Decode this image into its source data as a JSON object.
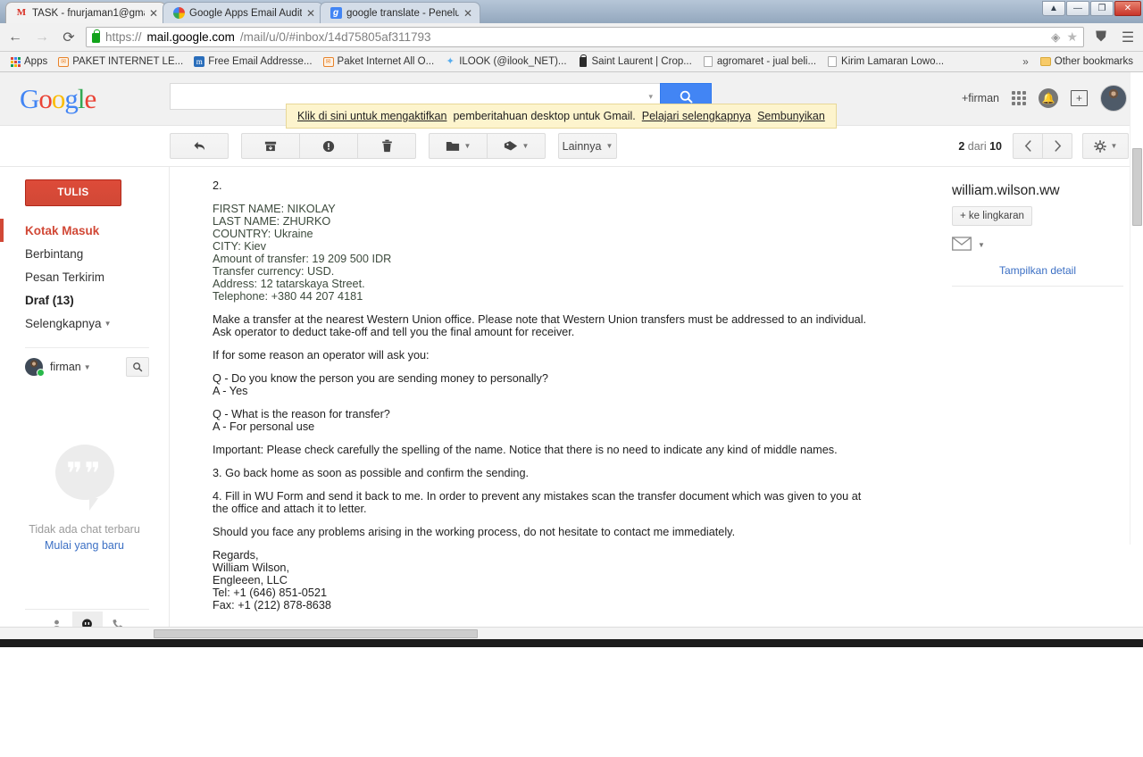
{
  "browser": {
    "tabs": [
      {
        "title": "TASK - fnurjaman1@gma",
        "favicon": "gmail-icon",
        "active": true
      },
      {
        "title": "Google Apps Email Audit",
        "favicon": "google-apps-icon",
        "active": false
      },
      {
        "title": "google translate - Penelu",
        "favicon": "google-translate-icon",
        "active": false
      }
    ],
    "window_controls": {
      "pin": "▲",
      "minimize": "—",
      "maximize": "❐",
      "close": "✕"
    },
    "nav": {
      "back": "←",
      "forward": "→",
      "reload": "⟳"
    },
    "url": {
      "scheme": "https://",
      "host": "mail.google.com",
      "path": "/mail/u/0/#inbox/14d75805af311793"
    },
    "omnibox_right": {
      "extension": "◈",
      "bookmark_star": "★",
      "shield": "⛊",
      "menu": "☰"
    },
    "bookmarks": [
      {
        "label": "Apps",
        "icon": "apps-grid-icon"
      },
      {
        "label": "PAKET INTERNET LE...",
        "icon": "orange-page-icon"
      },
      {
        "label": "Free Email Addresse...",
        "icon": "m-blue-icon"
      },
      {
        "label": "Paket Internet All O...",
        "icon": "orange-page-icon"
      },
      {
        "label": "ILOOK (@ilook_NET)...",
        "icon": "twitter-icon"
      },
      {
        "label": "Saint Laurent | Crop...",
        "icon": "bag-icon"
      },
      {
        "label": "agromaret - jual beli...",
        "icon": "page-icon"
      },
      {
        "label": "Kirim Lamaran Lowo...",
        "icon": "page-icon"
      }
    ],
    "bookmarks_overflow": "»",
    "other_bookmarks": "Other bookmarks"
  },
  "gmail": {
    "logo_letters": [
      "G",
      "o",
      "o",
      "g",
      "l",
      "e"
    ],
    "search": {
      "value": "",
      "placeholder": "",
      "caret": "▾",
      "button_icon": "search-icon"
    },
    "account": {
      "plus_label": "+firman",
      "apps_icon": "apps-grid-icon",
      "notifications_icon": "bell-icon",
      "share_icon": "share-icon",
      "avatar": "user-avatar"
    },
    "notification": {
      "link_text": "Klik di sini untuk mengaktifkan",
      "body_text": "pemberitahuan desktop untuk Gmail.",
      "learn_more": "Pelajari selengkapnya",
      "hide": "Sembunyikan"
    },
    "toolbar": {
      "back_icon": "back-arrow-icon",
      "archive_icon": "archive-icon",
      "spam_icon": "report-spam-icon",
      "delete_icon": "trash-icon",
      "move_icon": "move-to-folder-icon",
      "label_icon": "labels-icon",
      "more_label": "Lainnya",
      "count_current": "2",
      "count_of": "dari",
      "count_total": "10",
      "prev_icon": "chevron-left-icon",
      "next_icon": "chevron-right-icon",
      "settings_icon": "gear-icon"
    },
    "sidebar": {
      "compose_label": "TULIS",
      "items": [
        {
          "label": "Kotak Masuk",
          "state": "active"
        },
        {
          "label": "Berbintang",
          "state": "normal"
        },
        {
          "label": "Pesan Terkirim",
          "state": "normal"
        },
        {
          "label": "Draf (13)",
          "state": "bold"
        },
        {
          "label": "Selengkapnya",
          "state": "more"
        }
      ],
      "chat": {
        "user_name": "firman",
        "search_icon": "search-icon",
        "empty_title": "Tidak ada chat terbaru",
        "empty_link": "Mulai yang baru",
        "footer_icons": [
          "contacts-icon",
          "hangouts-icon",
          "phone-icon"
        ]
      }
    },
    "message": {
      "item_number": "2.",
      "details": "FIRST NAME: NIKOLAY\nLAST NAME: ZHURKO\nCOUNTRY: Ukraine\nCITY: Kiev\nAmount of transfer: 19 209 500 IDR\nTransfer currency: USD.\nAddress: 12 tatarskaya Street.\nTelephone: +380 44 207 4181",
      "paragraph_transfer": "Make a transfer at the nearest Western Union office. Please note that Western Union transfers must be addressed to an individual. Ask operator to deduct take-off and tell you the final amount for receiver.",
      "paragraph_operator": "If for some reason an operator will ask you:",
      "qa1": "Q - Do you know the person you are sending money to personally?\nA - Yes",
      "qa2": "Q - What is the reason for transfer?\nA - For personal use",
      "paragraph_important": "Important: Please check carefully the spelling of the name. Notice that there is no need to indicate any kind of middle names.",
      "paragraph_step3": "3. Go back home as soon as possible and confirm the sending.",
      "paragraph_step4": "4. Fill in WU Form and send it back to me. In order to prevent any mistakes scan the transfer document which was given to you at the office and attach it to letter.",
      "paragraph_problems": "Should you face any problems arising in the working process, do not hesitate to contact me immediately.",
      "signature": "Regards,\nWilliam Wilson,\nEngleeen, LLC\nTel: +1 (646) 851-0521\nFax: +1 (212) 878-8638"
    },
    "contact_panel": {
      "name": "william.wilson.ww",
      "add_circle_label": "+ ke lingkaran",
      "email_icon": "envelope-icon",
      "caret_icon": "chevron-down-icon",
      "show_details": "Tampilkan detail"
    }
  },
  "colors": {
    "gmail_red": "#d14836",
    "google_blue": "#4285f4",
    "link_blue": "#3b6fc4",
    "notif_bg": "#fdf4cd",
    "chrome_gray": "#f1f1f1"
  }
}
